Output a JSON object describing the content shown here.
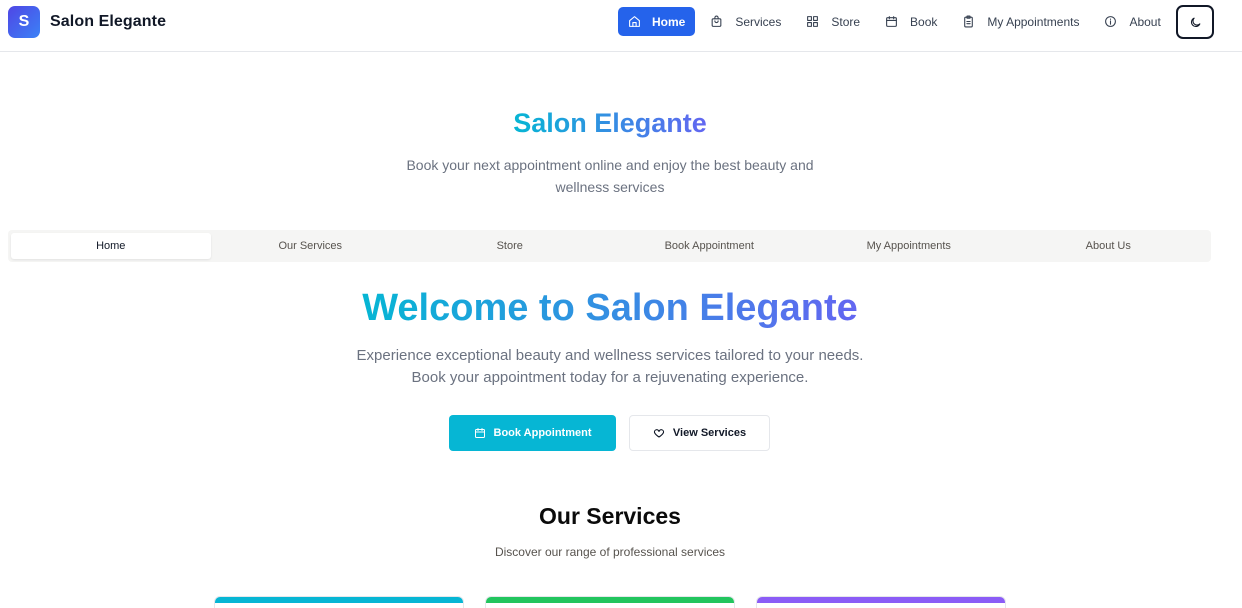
{
  "brand": {
    "logo_letter": "S",
    "name": "Salon Elegante"
  },
  "nav": {
    "items": [
      {
        "label": "Home",
        "icon": "home-icon"
      },
      {
        "label": "Services",
        "icon": "bag-icon"
      },
      {
        "label": "Store",
        "icon": "grid-icon"
      },
      {
        "label": "Book",
        "icon": "calendar-icon"
      },
      {
        "label": "My Appointments",
        "icon": "clipboard-icon"
      },
      {
        "label": "About",
        "icon": "info-icon"
      }
    ],
    "active_index": 0,
    "theme_icon": "moon-icon"
  },
  "hero": {
    "title": "Salon Elegante",
    "subtitle": "Book your next appointment online and enjoy the best beauty and wellness services"
  },
  "tabs": {
    "items": [
      "Home",
      "Our Services",
      "Store",
      "Book Appointment",
      "My Appointments",
      "About Us"
    ],
    "active_index": 0
  },
  "welcome": {
    "title": "Welcome to Salon Elegante",
    "subtitle_line1": "Experience exceptional beauty and wellness services tailored to your needs.",
    "subtitle_line2": "Book your appointment today for a rejuvenating experience.",
    "primary_button": "Book Appointment",
    "secondary_button": "View Services"
  },
  "services": {
    "title": "Our Services",
    "subtitle": "Discover our range of professional services",
    "card_colors": [
      "#06b6d4",
      "#22c55e",
      "#8b5cf6"
    ]
  },
  "colors": {
    "primary": "#2563eb",
    "accent": "#06b6d4",
    "gradient_start": "#06b6d4",
    "gradient_end": "#6366f1"
  }
}
